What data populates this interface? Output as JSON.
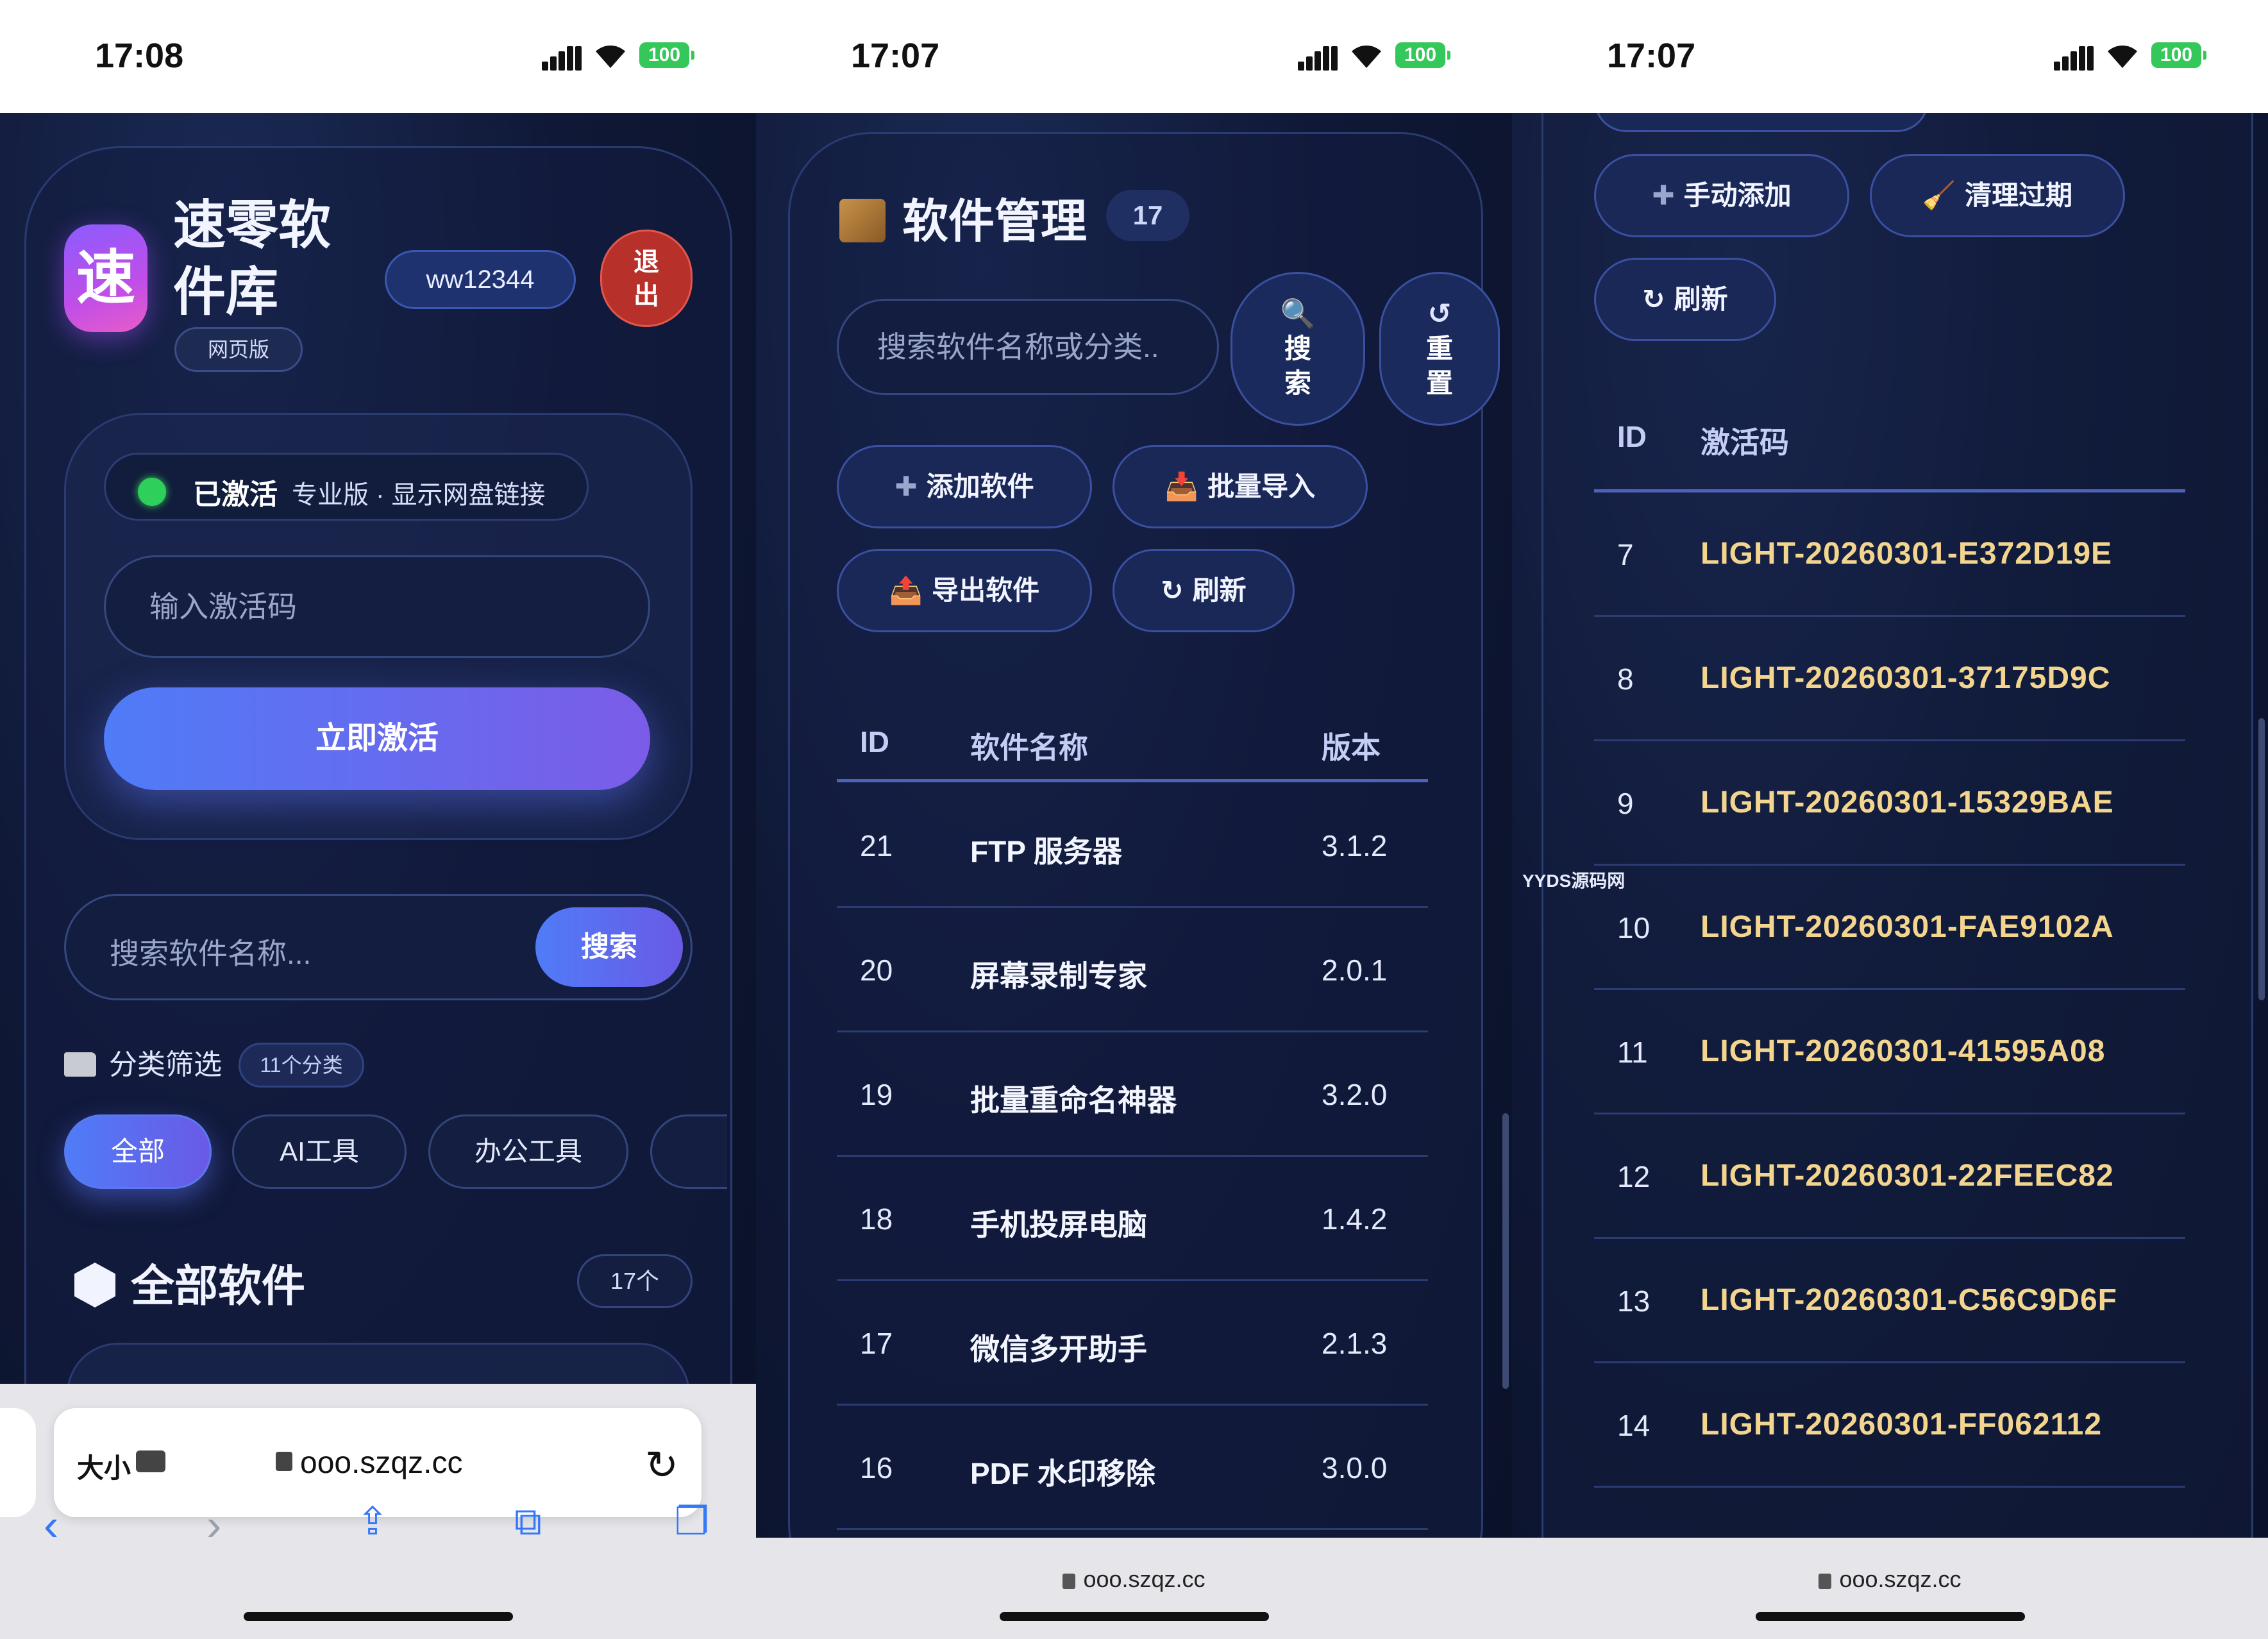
{
  "panel1": {
    "status": {
      "time": "17:08",
      "battery": "100"
    },
    "app": {
      "logo_char": "速",
      "name_line1": "速零软",
      "name_line2": "件库",
      "web_badge": "网页版",
      "username": "ww12344",
      "logout_line1": "退",
      "logout_line2": "出"
    },
    "activation": {
      "status_label": "已激活",
      "status_sub": "专业版 · 显示网盘链接",
      "code_placeholder": "输入激活码",
      "activate_button": "立即激活"
    },
    "search": {
      "placeholder": "搜索软件名称...",
      "button": "搜索"
    },
    "categories": {
      "label": "分类筛选",
      "count": "11个分类",
      "chips": [
        "全部",
        "AI工具",
        "办公工具"
      ]
    },
    "all_software": {
      "title": "全部软件",
      "count": "17个"
    },
    "browser": {
      "text_size": "大小",
      "url": "ooo.szqz.cc"
    }
  },
  "panel2": {
    "status": {
      "time": "17:07",
      "battery": "100"
    },
    "title": "软件管理",
    "count": "17",
    "search_placeholder": "搜索软件名称或分类..",
    "search_button_l1": "搜",
    "search_button_l2": "索",
    "reset_button_l1": "重",
    "reset_button_l2": "置",
    "buttons": {
      "add": "添加软件",
      "import": "批量导入",
      "export": "导出软件",
      "refresh": "刷新"
    },
    "table": {
      "headers": {
        "id": "ID",
        "name": "软件名称",
        "version": "版本"
      },
      "rows": [
        {
          "id": "21",
          "name": "FTP 服务器",
          "version": "3.1.2"
        },
        {
          "id": "20",
          "name": "屏幕录制专家",
          "version": "2.0.1"
        },
        {
          "id": "19",
          "name": "批量重命名神器",
          "version": "3.2.0"
        },
        {
          "id": "18",
          "name": "手机投屏电脑",
          "version": "1.4.2"
        },
        {
          "id": "17",
          "name": "微信多开助手",
          "version": "2.1.3"
        },
        {
          "id": "16",
          "name": "PDF 水印移除",
          "version": "3.0.0"
        }
      ]
    },
    "browser": {
      "url": "ooo.szqz.cc"
    }
  },
  "panel3": {
    "status": {
      "time": "17:07",
      "battery": "100"
    },
    "buttons": {
      "manual_add": "手动添加",
      "clean_expired": "清理过期",
      "refresh": "刷新"
    },
    "table": {
      "headers": {
        "id": "ID",
        "code": "激活码"
      },
      "rows": [
        {
          "id": "7",
          "code": "LIGHT-20260301-E372D19E"
        },
        {
          "id": "8",
          "code": "LIGHT-20260301-37175D9C"
        },
        {
          "id": "9",
          "code": "LIGHT-20260301-15329BAE"
        },
        {
          "id": "10",
          "code": "LIGHT-20260301-FAE9102A"
        },
        {
          "id": "11",
          "code": "LIGHT-20260301-41595A08"
        },
        {
          "id": "12",
          "code": "LIGHT-20260301-22FEEC82"
        },
        {
          "id": "13",
          "code": "LIGHT-20260301-C56C9D6F"
        },
        {
          "id": "14",
          "code": "LIGHT-20260301-FF062112"
        }
      ]
    },
    "watermark": "YYDS源码网",
    "browser": {
      "url": "ooo.szqz.cc"
    }
  },
  "colors": {
    "accent": "#4f7cf7",
    "accent2": "#7b5ce8",
    "code_gold": "#f3d58e",
    "bg": "#0d1530"
  },
  "icons": [
    "signal-icon",
    "wifi-icon",
    "battery-icon",
    "folder-icon",
    "hexagon-icon",
    "box-icon",
    "magnifier-icon",
    "reset-icon",
    "plus-icon",
    "inbox-tray-icon",
    "refresh-icon",
    "broom-icon",
    "lock-icon",
    "reload-icon",
    "back-icon",
    "forward-icon",
    "share-icon",
    "bookmarks-icon",
    "tabs-icon"
  ]
}
